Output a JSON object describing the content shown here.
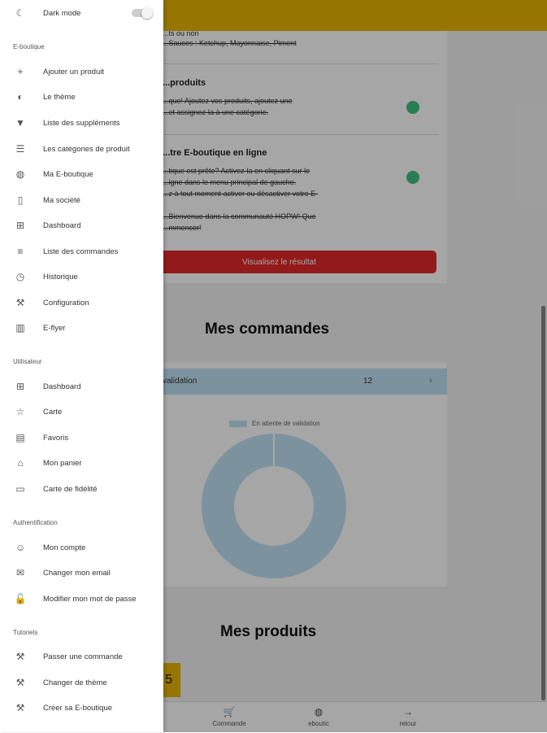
{
  "drawer": {
    "dark_mode_label": "Dark mode",
    "sections": {
      "eboutique": "E-boutique",
      "utilisateur": "Utilisateur",
      "authentification": "Authentification",
      "tutoriels": "Tutoriels"
    },
    "eboutique_items": [
      {
        "label": "Ajouter un produit",
        "icon": "plus-icon"
      },
      {
        "label": "Le thème",
        "icon": "palette-icon"
      },
      {
        "label": "Liste des suppléments",
        "icon": "pizza-icon"
      },
      {
        "label": "Les catégories de produit",
        "icon": "filter-icon"
      },
      {
        "label": "Ma E-boutique",
        "icon": "globe-icon"
      },
      {
        "label": "Ma société",
        "icon": "building-icon"
      },
      {
        "label": "Dashboard",
        "icon": "grid-icon"
      },
      {
        "label": "Liste des commandes",
        "icon": "list-icon"
      },
      {
        "label": "Historique",
        "icon": "clock-icon"
      },
      {
        "label": "Configuration",
        "icon": "wrench-icon"
      },
      {
        "label": "E-flyer",
        "icon": "book-icon"
      }
    ],
    "utilisateur_items": [
      {
        "label": "Dashboard",
        "icon": "grid-icon"
      },
      {
        "label": "Carte",
        "icon": "star-icon"
      },
      {
        "label": "Favoris",
        "icon": "map-icon"
      },
      {
        "label": "Mon panier",
        "icon": "basket-icon"
      },
      {
        "label": "Carte de fidélité",
        "icon": "card-icon"
      }
    ],
    "authentification_items": [
      {
        "label": "Mon compte",
        "icon": "user-icon"
      },
      {
        "label": "Changer mon email",
        "icon": "mail-icon"
      },
      {
        "label": "Modifier mon mot de passe",
        "icon": "lock-icon"
      }
    ],
    "tutoriels_items": [
      {
        "label": "Passer une commande",
        "icon": "hammer-icon"
      },
      {
        "label": "Changer de thème",
        "icon": "hammer-icon"
      },
      {
        "label": "Créer sa E-boutique",
        "icon": "hammer-icon"
      }
    ]
  },
  "main": {
    "card1": {
      "line1": "...ts ou non",
      "line2": "...Sauces : Ketchup, Mayonnaise, Piment",
      "products_title": "...produits",
      "products_text1": "...que! Ajoutez vos produits, ajoutez une",
      "products_text2": "...et assignez-la à une catégorie.",
      "online_title": "...tre E-boutique en ligne",
      "online_text1": "...tique est prête? Activez-la en cliquant sur le",
      "online_text2": "...igne dans le menu principal de gauche.",
      "online_text3": "...z à tout moment activer ou désactiver votre E-",
      "online_text4": "...Bienvenue dans la communauté HOPW! Que",
      "online_text5": "...mmencer!",
      "button": "Visualisez le résultat"
    },
    "mes_commandes_title": "Mes commandes",
    "validation_row": {
      "label": "validation",
      "count": "12"
    },
    "chart_data": {
      "type": "pie",
      "labels": [
        "En attente de validation"
      ],
      "values": [
        12
      ],
      "colors": [
        "#bfe0f5"
      ]
    },
    "mes_produits_title": "Mes produits",
    "yellow_button_text": "5"
  },
  "bottom_nav": [
    {
      "label": "Commande",
      "icon": "cart-icon"
    },
    {
      "label": "eboutic",
      "icon": "globe-icon"
    },
    {
      "label": "retour",
      "icon": "arrow-right-icon"
    }
  ],
  "colors": {
    "accent": "#e6b500",
    "danger": "#e02828",
    "chart": "#bfe0f5"
  }
}
